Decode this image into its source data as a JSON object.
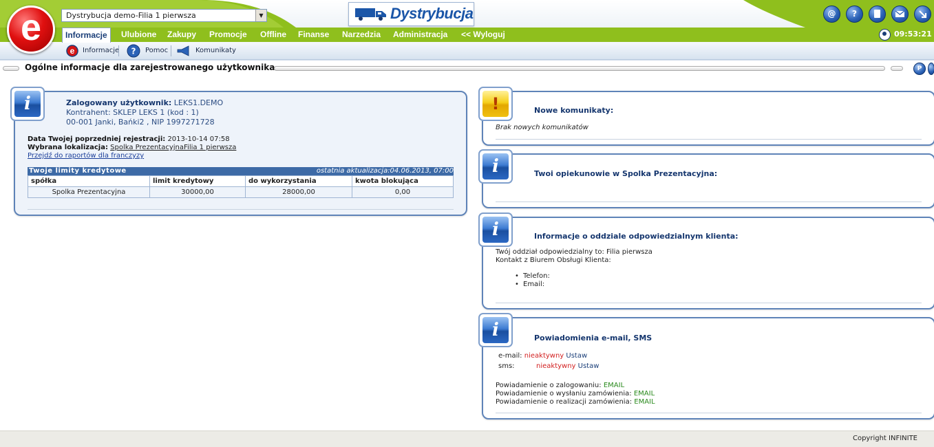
{
  "header": {
    "branch_select": "Dystrybucja demo-Filia 1 pierwsza",
    "app_title": "Dystrybucja",
    "logo_letter": "e",
    "top_icons": [
      "@",
      "?",
      "",
      "",
      ""
    ],
    "top_icon_names": [
      "email-icon",
      "help-icon",
      "document-icon",
      "mail-icon",
      "exit-icon"
    ],
    "clock": "09:53:21"
  },
  "nav": {
    "items": [
      "Informacje",
      "Ulubione",
      "Zakupy",
      "Promocje",
      "Offline",
      "Finanse",
      "Narzedzia",
      "Administracja",
      "<< Wyloguj"
    ],
    "active": "Informacje"
  },
  "subnav": {
    "items": [
      "Informacje",
      "Pomoc",
      "Komunikaty"
    ]
  },
  "titlebar": {
    "title": "Ogólne informacje dla zarejestrowanego użytkownika"
  },
  "user_panel": {
    "logged_label": "Zalogowany użytkownik:",
    "logged_value": "LEKS1.DEMO",
    "contractor": "Kontrahent: SKLEP LEKS 1 (kod : 1)",
    "address": "00-001 Janki, Bańki2 , NIP 1997271728",
    "last_login_label": "Data Twojej poprzedniej rejestracji:",
    "last_login_value": "2013-10-14 07:58",
    "location_label": "Wybrana lokalizacja:",
    "location_value": "Spolka PrezentacyjnaFilia 1 pierwsza",
    "franchise_link": "Przejdź do raportów dla franczyzy",
    "limits": {
      "title": "Twoje limity kredytowe",
      "updated": "ostatnia aktualizacja:04.06.2013, 07:00",
      "columns": [
        "spółka",
        "limit kredytowy",
        "do wykorzystania",
        "kwota blokująca"
      ],
      "rows": [
        [
          "Spolka Prezentacyjna",
          "30000,00",
          "28000,00",
          "0,00"
        ]
      ]
    }
  },
  "messages_panel": {
    "title": "Nowe komunikaty:",
    "text": "Brak nowych komunikatów"
  },
  "guardians_panel": {
    "title": "Twoi opiekunowie w Spolka Prezentacyjna:"
  },
  "branch_panel": {
    "title": "Informacje o oddziale odpowiedzialnym klienta:",
    "line1": "Twój oddział odpowiedzialny to: Filia pierwsza",
    "line2": "Kontakt z Biurem Obsługi Klienta:",
    "phone": "Telefon:",
    "email": "Email:"
  },
  "notify_panel": {
    "title": "Powiadomienia e-mail, SMS",
    "email_label": "e-mail:",
    "email_status": "nieaktywny",
    "email_action": "Ustaw",
    "sms_label": "sms:",
    "sms_status": "nieaktywny",
    "sms_action": "Ustaw",
    "n1_label": "Powiadamienie o zalogowaniu:",
    "n1_value": "EMAIL",
    "n2_label": "Powiadamienie o wysłaniu zamówienia:",
    "n2_value": "EMAIL",
    "n3_label": "Powiadamienie o realizacji zamówienia:",
    "n3_value": "EMAIL"
  },
  "footer": {
    "copyright": "Copyright INFINITE"
  },
  "colors": {
    "nav_green": "#8fbf1d",
    "panel_border": "#5e83b8",
    "title_blue": "#15366e",
    "inactive_red": "#d21f1f",
    "email_green": "#2a8a1d"
  }
}
